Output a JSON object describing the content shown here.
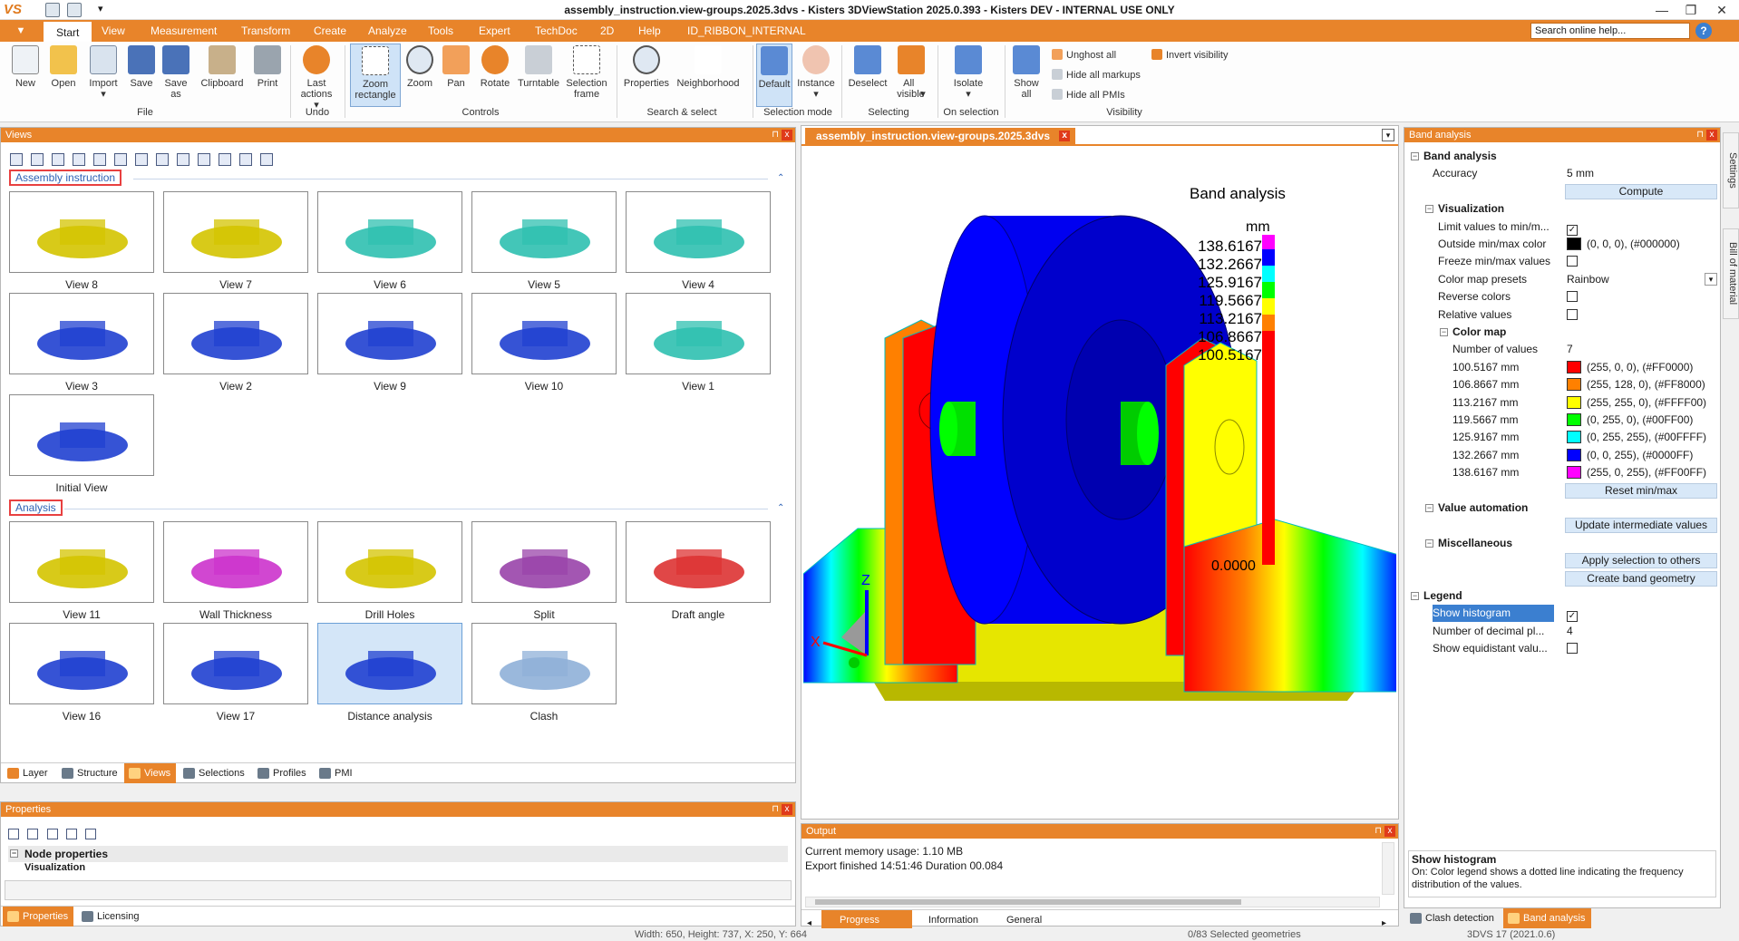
{
  "window": {
    "title": "assembly_instruction.view-groups.2025.3dvs - Kisters 3DViewStation 2025.0.393 - Kisters DEV - INTERNAL USE ONLY",
    "logo": "VS",
    "minimize": "—",
    "restore": "❐",
    "close": "✕"
  },
  "menu": {
    "app_button": "▼",
    "tabs": [
      "Start",
      "View",
      "Measurement",
      "Transform",
      "Create",
      "Analyze",
      "Tools",
      "Expert",
      "TechDoc",
      "2D",
      "Help",
      "ID_RIBBON_INTERNAL"
    ],
    "search_placeholder": "Search online help...",
    "help": "?"
  },
  "ribbon": {
    "file": {
      "group": "File",
      "buttons": [
        "New",
        "Open",
        "Import",
        "Save",
        "Save as",
        "Clipboard",
        "Print"
      ]
    },
    "undo": {
      "group": "Undo",
      "buttons": [
        "Last actions"
      ]
    },
    "controls": {
      "group": "Controls",
      "buttons": [
        "Zoom rectangle",
        "Zoom",
        "Pan",
        "Rotate",
        "Turntable",
        "Selection frame"
      ]
    },
    "search": {
      "group": "Search & select",
      "buttons": [
        "Properties",
        "Neighborhood"
      ]
    },
    "selmode": {
      "group": "Selection mode",
      "buttons": [
        "Default",
        "Instance"
      ]
    },
    "selecting": {
      "group": "Selecting",
      "buttons": [
        "Deselect",
        "All visible"
      ]
    },
    "onsel": {
      "group": "On selection",
      "buttons": [
        "Isolate"
      ]
    },
    "visibility": {
      "group": "Visibility",
      "buttons": [
        "Show all"
      ],
      "small": [
        "Unghost all",
        "Hide all markups",
        "Hide all PMIs",
        "Invert visibility"
      ]
    }
  },
  "views_panel": {
    "title": "Views",
    "pin": "⊓",
    "close": "x",
    "sections": [
      {
        "title": "Assembly instruction",
        "items": [
          "View 8",
          "View 7",
          "View 6",
          "View 5",
          "View 4",
          "View 3",
          "View 2",
          "View 9",
          "View 10",
          "View 1",
          "Initial View"
        ]
      },
      {
        "title": "Analysis",
        "items": [
          "View 11",
          "Wall Thickness",
          "Drill Holes",
          "Split",
          "Draft angle",
          "View 16",
          "View 17",
          "Distance analysis",
          "Clash"
        ]
      }
    ],
    "bottom_tabs": [
      "Layer",
      "Structure",
      "Views",
      "Selections",
      "Profiles",
      "PMI"
    ]
  },
  "properties_panel": {
    "title": "Properties",
    "node": "Node properties",
    "sub": "Visualization",
    "bottom_tabs": [
      "Properties",
      "Licensing"
    ]
  },
  "viewport": {
    "doc_tab": "assembly_instruction.view-groups.2025.3dvs",
    "doc_close": "x",
    "legend_title": "Band analysis",
    "unit": "mm",
    "legend_values": [
      "138.6167",
      "132.2667",
      "125.9167",
      "119.5667",
      "113.2167",
      "106.8667",
      "100.5167"
    ],
    "legend_min": "0.0000",
    "axis": {
      "x": "X",
      "z": "Z"
    }
  },
  "output_panel": {
    "title": "Output",
    "lines": [
      "Current memory usage: 1.10 MB",
      "Export finished 14:51:46 Duration 00.084"
    ],
    "tabs": [
      "Progress",
      "Information",
      "General"
    ]
  },
  "band_panel": {
    "title": "Band analysis",
    "root": "Band analysis",
    "accuracy": {
      "label": "Accuracy",
      "value": "5 mm"
    },
    "compute": "Compute",
    "visualization": "Visualization",
    "vis_rows": [
      {
        "label": "Limit values to min/m...",
        "value": "✓",
        "type": "check"
      },
      {
        "label": "Outside min/max color",
        "value": "(0, 0, 0), (#000000)",
        "type": "color",
        "color": "#000000"
      },
      {
        "label": "Freeze min/max values",
        "value": "",
        "type": "check"
      },
      {
        "label": "Color map presets",
        "value": "Rainbow",
        "type": "select"
      },
      {
        "label": "Reverse colors",
        "value": "",
        "type": "check"
      },
      {
        "label": "Relative values",
        "value": "",
        "type": "check"
      }
    ],
    "colormap": "Color map",
    "num_values": {
      "label": "Number of values",
      "value": "7"
    },
    "colors": [
      {
        "label": "100.5167 mm",
        "value": "(255, 0, 0), (#FF0000)",
        "color": "#FF0000"
      },
      {
        "label": "106.8667 mm",
        "value": "(255, 128, 0), (#FF8000)",
        "color": "#FF8000"
      },
      {
        "label": "113.2167 mm",
        "value": "(255, 255, 0), (#FFFF00)",
        "color": "#FFFF00"
      },
      {
        "label": "119.5667 mm",
        "value": "(0, 255, 0), (#00FF00)",
        "color": "#00FF00"
      },
      {
        "label": "125.9167 mm",
        "value": "(0, 255, 255), (#00FFFF)",
        "color": "#00FFFF"
      },
      {
        "label": "132.2667 mm",
        "value": "(0, 0, 255), (#0000FF)",
        "color": "#0000FF"
      },
      {
        "label": "138.6167 mm",
        "value": "(255, 0, 255), (#FF00FF)",
        "color": "#FF00FF"
      }
    ],
    "reset": "Reset min/max",
    "value_automation": "Value automation",
    "update": "Update intermediate values",
    "misc": "Miscellaneous",
    "apply": "Apply selection to others",
    "create": "Create band geometry",
    "legend": "Legend",
    "legend_rows": [
      {
        "label": "Show histogram",
        "value": "✓",
        "type": "check"
      },
      {
        "label": "Number of decimal pl...",
        "value": "4",
        "type": "text"
      },
      {
        "label": "Show equidistant valu...",
        "value": "",
        "type": "check"
      }
    ],
    "help_title": "Show histogram",
    "help_text": "On: Color legend shows a dotted line indicating the frequency distribution of the values.",
    "bottom_tabs": [
      "Clash detection",
      "Band analysis"
    ]
  },
  "side_tabs": [
    "Settings",
    "Bill of material"
  ],
  "status": {
    "dims": "Width: 650, Height: 737, X: 250, Y: 664",
    "selected": "0/83 Selected geometries",
    "version": "3DVS 17 (2021.0.6)"
  },
  "colors": {
    "accent": "#e8842a",
    "selection": "#cfe3f7"
  }
}
